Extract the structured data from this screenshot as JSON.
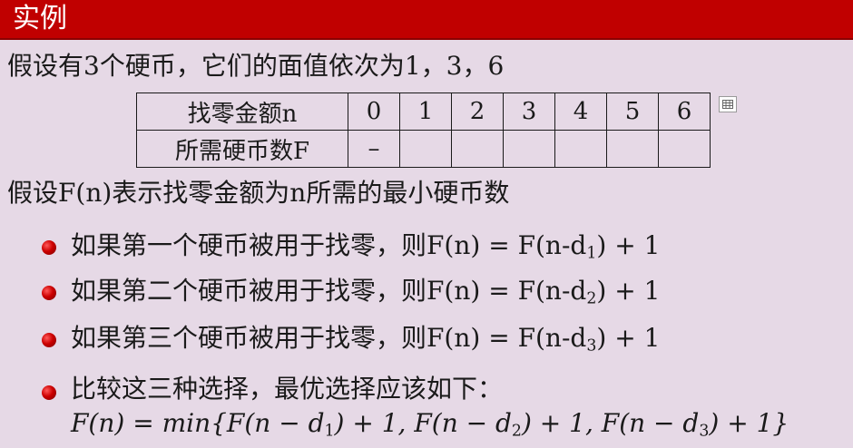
{
  "header": {
    "title": "实例"
  },
  "intro": "假设有3个硬币，它们的面值依次为1，3，6",
  "table": {
    "row1_label": "找零金额n",
    "row1_values": [
      "0",
      "1",
      "2",
      "3",
      "4",
      "5",
      "6"
    ],
    "row2_label": "所需硬币数F",
    "row2_values": [
      "–",
      "",
      "",
      "",
      "",
      "",
      ""
    ]
  },
  "icons": {
    "table_icon": "table-icon"
  },
  "definition": "假设F(n)表示找零金额为n所需的最小硬币数",
  "bullets": [
    {
      "text": "如果第一个硬币被用于找零，则F(n) = F(n-d",
      "sub": "1",
      "tail": ") + 1"
    },
    {
      "text": "如果第二个硬币被用于找零，则F(n) = F(n-d",
      "sub": "2",
      "tail": ") + 1"
    },
    {
      "text": "如果第三个硬币被用于找零，则F(n) = F(n-d",
      "sub": "3",
      "tail": ") + 1"
    },
    {
      "text": "比较这三种选择，最优选择应该如下："
    }
  ],
  "formula": {
    "p1": "F(n) = min{F(n − d",
    "s1": "1",
    "p2": ") + 1, F(n − d",
    "s2": "2",
    "p3": ") + 1, F(n − d",
    "s3": "3",
    "p4": ") + 1}"
  }
}
